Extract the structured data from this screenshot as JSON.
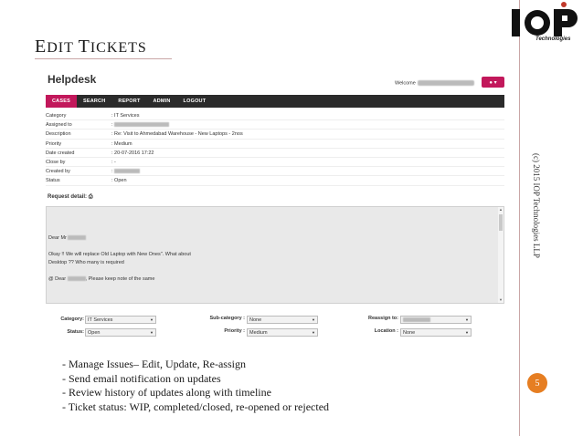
{
  "slide": {
    "title_first_big": "E",
    "title_first_rest": "DIT ",
    "title_second_big": "T",
    "title_second_rest": "ICKETS",
    "copyright": "(c) 2015 IOP Technologies LLP",
    "page_number": "5",
    "logo_text": "IOP",
    "logo_subtext": "Technologies",
    "bullets": [
      "- Manage Issues– Edit, Update, Re-assign",
      "- Send email notification on updates",
      "- Review history of updates along with timeline",
      "- Ticket status: WIP, completed/closed, re-opened or rejected"
    ]
  },
  "app": {
    "title": "Helpdesk",
    "welcome_label": "Welcome",
    "user_button": "● ▾",
    "nav": [
      "CASES",
      "SEARCH",
      "REPORT",
      "ADMIN",
      "LOGOUT"
    ],
    "details": [
      {
        "label": "Category",
        "value": ": IT Services"
      },
      {
        "label": "Assigned to",
        "value": ":"
      },
      {
        "label": "Description",
        "value": ": Re: Visit to Ahmedabad Warehouse - New Laptops - 2nos"
      },
      {
        "label": "Priority",
        "value": ": Medium"
      },
      {
        "label": "Date created",
        "value": ": 20-07-2016 17:22"
      },
      {
        "label": "Close by",
        "value": ": -"
      },
      {
        "label": "Created by",
        "value": ":"
      },
      {
        "label": "Status",
        "value": ": Open"
      }
    ],
    "request_detail_label": "Request detail:",
    "mail": {
      "line1": "Dear Mr",
      "line2": "Okay !! We will replace Old Laptop with New Ones\". What about",
      "line3": "Desktop ?? Who many is required",
      "line4_pre": "@ Dear",
      "line4_post": ", Please keep note of the same"
    },
    "form": {
      "category_label": "Category:",
      "category_value": "IT Services",
      "subcategory_label": "Sub-category :",
      "subcategory_value": "None",
      "reassign_label": "Reassign to:",
      "status_label": "Status:",
      "status_value": "Open",
      "priority_label": "Priority :",
      "priority_value": "Medium",
      "location_label": "Location :",
      "location_value": "None"
    }
  },
  "colors": {
    "accent": "#c2185b",
    "nav_bg": "#2b2b2b",
    "page_num_bg": "#e67e22",
    "rule": "#c9a6a6"
  }
}
